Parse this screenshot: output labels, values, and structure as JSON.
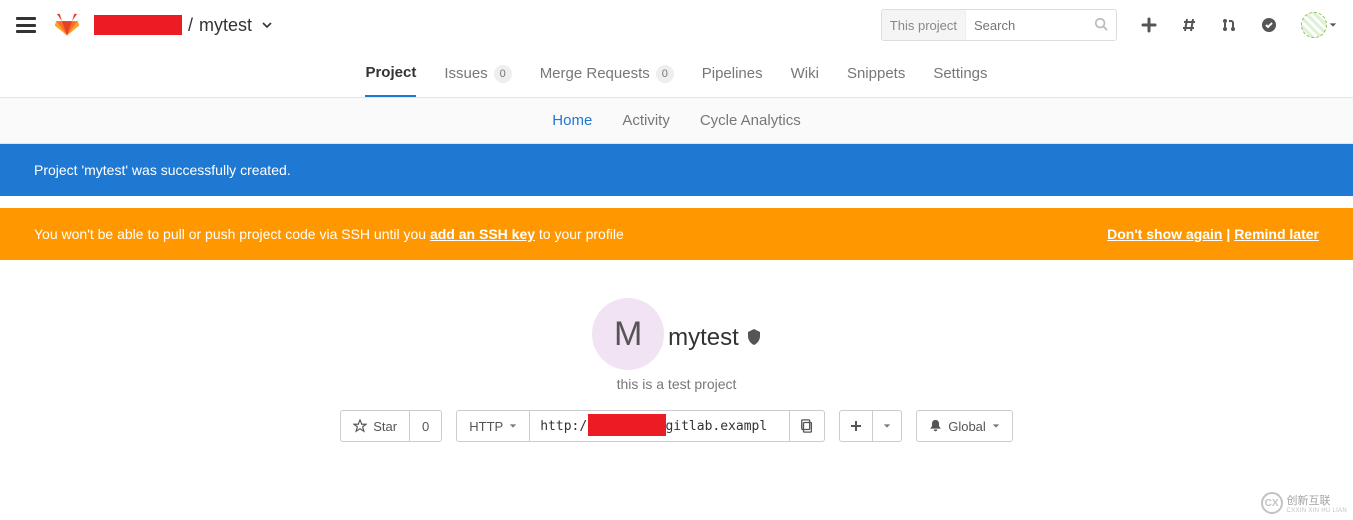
{
  "header": {
    "owner": "[redacted]",
    "separator": "/",
    "project": "mytest",
    "search_scope": "This project",
    "search_placeholder": "Search"
  },
  "tabs": {
    "project": "Project",
    "issues": "Issues",
    "issues_count": "0",
    "merge_requests": "Merge Requests",
    "merge_requests_count": "0",
    "pipelines": "Pipelines",
    "wiki": "Wiki",
    "snippets": "Snippets",
    "settings": "Settings"
  },
  "subtabs": {
    "home": "Home",
    "activity": "Activity",
    "cycle": "Cycle Analytics"
  },
  "banners": {
    "success": "Project 'mytest' was successfully created.",
    "warn_pre": "You won't be able to pull or push project code via SSH until you ",
    "warn_link": "add an SSH key",
    "warn_post": " to your profile",
    "dont_show": "Don't show again",
    "sep": " | ",
    "remind": "Remind later"
  },
  "project_card": {
    "avatar_letter": "M",
    "name": "mytest",
    "description": "this is a test project"
  },
  "actions": {
    "star": "Star",
    "star_count": "0",
    "protocol": "HTTP",
    "clone_url": "http://        @gitlab.exampl",
    "notify": "Global"
  },
  "watermark": {
    "brand": "创新互联",
    "sub": "CXXIN XIN HU LIAN"
  }
}
